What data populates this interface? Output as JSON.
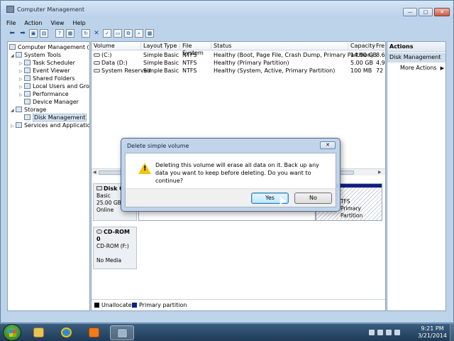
{
  "window": {
    "title": "Computer Management",
    "controls": [
      "minimize",
      "maximize",
      "close"
    ]
  },
  "menu": [
    "File",
    "Action",
    "View",
    "Help"
  ],
  "tree": [
    {
      "label": "Computer Management (Local",
      "level": 0
    },
    {
      "label": "System Tools",
      "level": 1
    },
    {
      "label": "Task Scheduler",
      "level": 2
    },
    {
      "label": "Event Viewer",
      "level": 2
    },
    {
      "label": "Shared Folders",
      "level": 2
    },
    {
      "label": "Local Users and Groups",
      "level": 2
    },
    {
      "label": "Performance",
      "level": 2
    },
    {
      "label": "Device Manager",
      "level": 2
    },
    {
      "label": "Storage",
      "level": 1
    },
    {
      "label": "Disk Management",
      "level": 2
    },
    {
      "label": "Services and Applications",
      "level": 1
    }
  ],
  "volumes": {
    "headers": [
      "Volume",
      "Layout",
      "Type",
      "File System",
      "Status",
      "Capacity",
      "Fre"
    ],
    "rows": [
      [
        "(C:)",
        "Simple",
        "Basic",
        "NTFS",
        "Healthy (Boot, Page File, Crash Dump, Primary Partition)",
        "14.90 GB",
        "8.6"
      ],
      [
        "Data (D:)",
        "Simple",
        "Basic",
        "NTFS",
        "Healthy (Primary Partition)",
        "5.00 GB",
        "4.9"
      ],
      [
        "System Reserved",
        "Simple",
        "Basic",
        "NTFS",
        "Healthy (System, Active, Primary Partition)",
        "100 MB",
        "72"
      ]
    ]
  },
  "disks": [
    {
      "name": "Disk 0",
      "type": "Basic",
      "size": "25.00 GB",
      "status": "Online",
      "part_text": [
        "TFS",
        "Primary Partition"
      ]
    },
    {
      "name": "CD-ROM 0",
      "type": "CD-ROM (F:)",
      "size": "",
      "status": "No Media"
    }
  ],
  "legend": [
    "Unallocated",
    "Primary partition"
  ],
  "actions": {
    "title": "Actions",
    "items": [
      "Disk Management",
      "More Actions"
    ]
  },
  "dialog": {
    "title": "Delete simple volume",
    "message": "Deleting this volume will erase all data on it. Back up any data you want to keep before deleting. Do you want to continue?",
    "yes": "Yes",
    "no": "No"
  },
  "taskbar": {
    "time": "9:21 PM",
    "date": "3/21/2014"
  },
  "colors": {
    "primary_partition": "#0f1f84",
    "unallocated": "#000000"
  }
}
